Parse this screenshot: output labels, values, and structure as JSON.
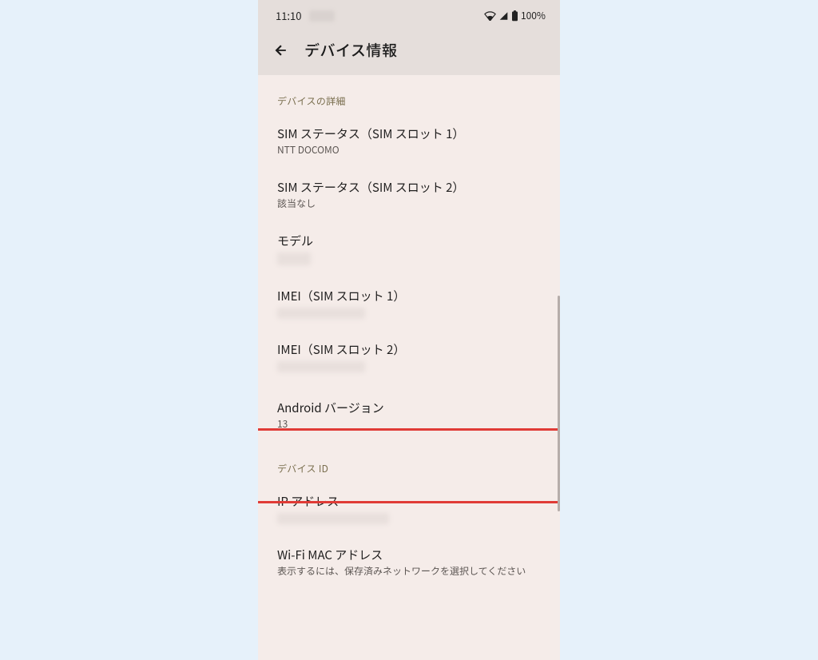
{
  "statusbar": {
    "time": "11:10",
    "battery": "100%"
  },
  "header": {
    "title": "デバイス情報"
  },
  "sections": {
    "device_details_header": "デバイスの詳細",
    "device_id_header": "デバイス ID"
  },
  "rows": {
    "sim1": {
      "label": "SIM ステータス（SIM スロット 1）",
      "sub": "NTT DOCOMO"
    },
    "sim2": {
      "label": "SIM ステータス（SIM スロット 2）",
      "sub": "該当なし"
    },
    "model": {
      "label": "モデル"
    },
    "imei1": {
      "label": "IMEI（SIM スロット 1）"
    },
    "imei2": {
      "label": "IMEI（SIM スロット 2）"
    },
    "android_version": {
      "label": "Android バージョン",
      "sub": "13"
    },
    "ip": {
      "label": "IP アドレス"
    },
    "wifi_mac": {
      "label": "Wi-Fi MAC アドレス",
      "sub": "表示するには、保存済みネットワークを選択してください"
    }
  }
}
